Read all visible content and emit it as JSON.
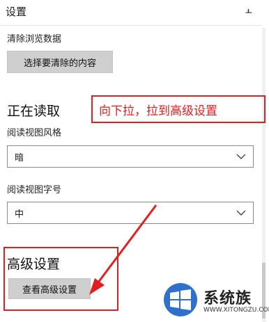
{
  "panel": {
    "title": "设置",
    "pin_icon": "pin-icon"
  },
  "clear_data": {
    "label": "清除浏览数据",
    "button": "选择要清除的内容"
  },
  "reading": {
    "heading": "正在读取",
    "view_style": {
      "label": "阅读视图风格",
      "value": "暗"
    },
    "font_size": {
      "label": "阅读视图字号",
      "value": "中"
    }
  },
  "advanced": {
    "heading": "高级设置",
    "button": "查看高级设置"
  },
  "annotation": {
    "text": "向下拉，拉到高级设置",
    "color": "#e02020"
  },
  "watermark": {
    "brand": "系统族",
    "url": "WWW.XITONGZU.COM"
  },
  "colors": {
    "button_bg": "#cfcfcf",
    "logo_blue": "#1c64c8"
  }
}
